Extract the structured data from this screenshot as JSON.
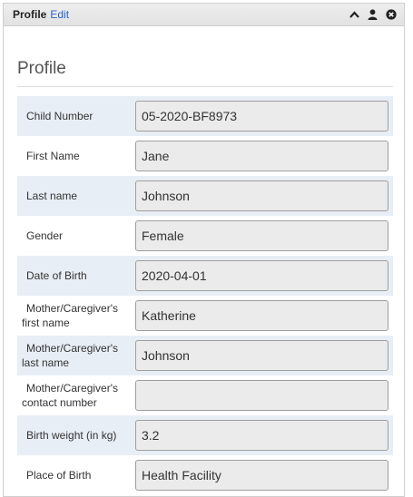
{
  "header": {
    "title": "Profile",
    "edit_label": "Edit",
    "icons": [
      "chevron-up-icon",
      "person-icon",
      "close-circle-icon"
    ]
  },
  "section": {
    "title": "Profile"
  },
  "fields": [
    {
      "label": "Child Number",
      "value": "05-2020-BF8973"
    },
    {
      "label": "First Name",
      "value": "Jane"
    },
    {
      "label": "Last name",
      "value": "Johnson"
    },
    {
      "label": "Gender",
      "value": "Female"
    },
    {
      "label": "Date of Birth",
      "value": "2020-04-01"
    },
    {
      "label": "Mother/Caregiver's first name",
      "value": "Katherine"
    },
    {
      "label": "Mother/Caregiver's last name",
      "value": "Johnson"
    },
    {
      "label": "Mother/Caregiver's contact number",
      "value": ""
    },
    {
      "label": "Birth weight (in kg)",
      "value": "3.2"
    },
    {
      "label": "Place of Birth",
      "value": "Health Facility"
    }
  ],
  "colors": {
    "row_shade": "#e8eef6",
    "link": "#2a63c9",
    "field_bg": "#ebebeb"
  }
}
